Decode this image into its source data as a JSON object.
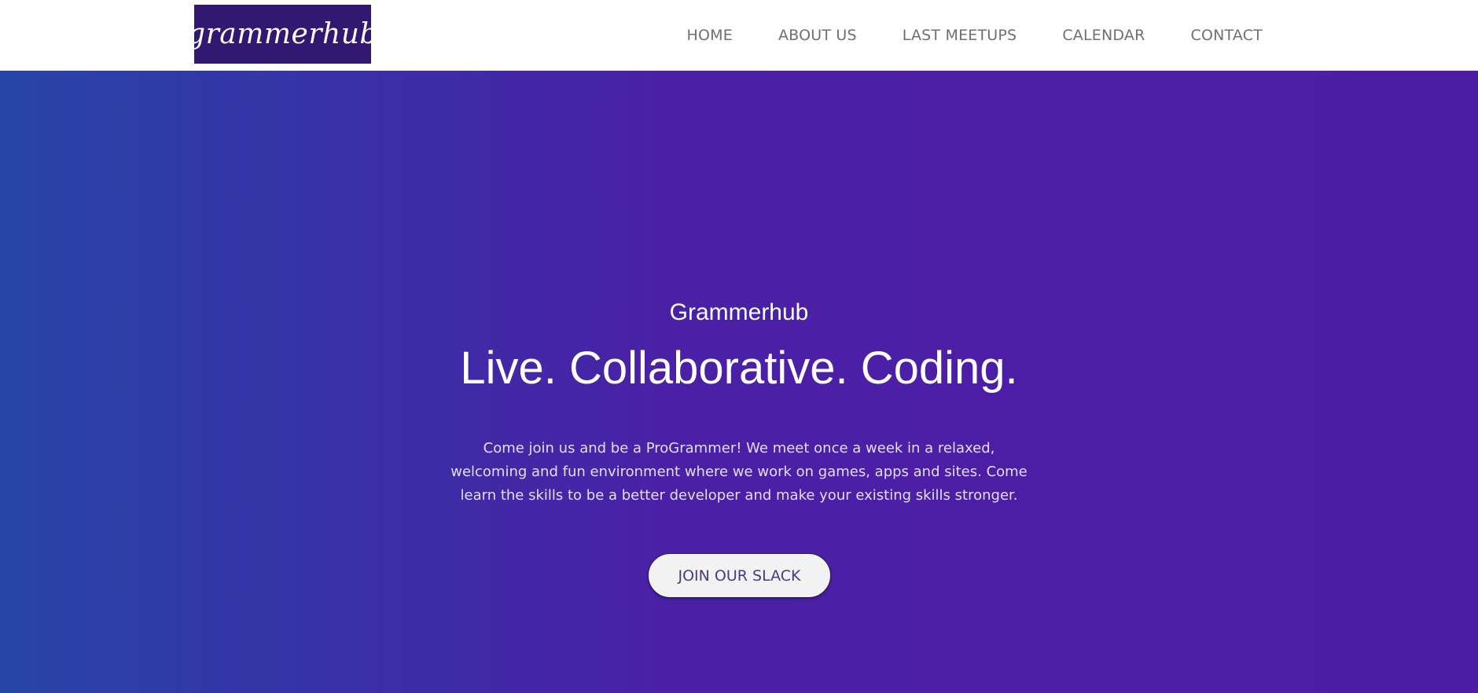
{
  "header": {
    "logo_text": "{grammerhub}",
    "nav": [
      {
        "label": "HOME"
      },
      {
        "label": "ABOUT US"
      },
      {
        "label": "LAST MEETUPS"
      },
      {
        "label": "CALENDAR"
      },
      {
        "label": "CONTACT"
      }
    ]
  },
  "hero": {
    "subtitle": "Grammerhub",
    "title": "Live. Collaborative. Coding.",
    "description": "Come join us and be a ProGrammer! We meet once a week in a relaxed, welcoming and fun environment where we work on games, apps and sites. Come learn the skills to be a better developer and make your existing skills stronger.",
    "cta_label": "JOIN OUR SLACK"
  },
  "colors": {
    "logo_bg": "#321870",
    "hero_gradient_start": "#2745a8",
    "hero_gradient_end": "#4c1ca4",
    "nav_text": "#707070"
  }
}
